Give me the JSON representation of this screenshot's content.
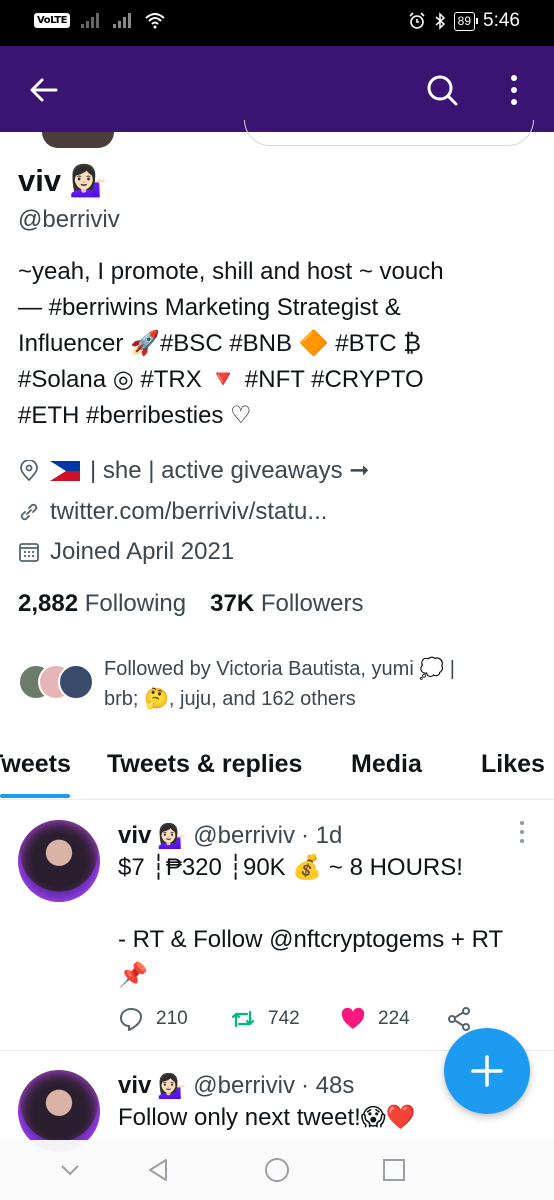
{
  "status_bar": {
    "network_badge": "VoLTE",
    "battery": "89",
    "time": "5:46",
    "icons": [
      "signal-icon",
      "wifi-icon",
      "alarm-icon",
      "bluetooth-icon",
      "battery-icon"
    ]
  },
  "app_bar": {
    "background": "#3b1473",
    "icons": [
      "back-arrow-icon",
      "search-icon",
      "more-vertical-icon"
    ]
  },
  "profile": {
    "name": "viv",
    "name_emoji": "💁🏻‍♀️",
    "handle": "@berriviv",
    "bio_lines": [
      "~yeah, I promote, shill and host ~ vouch",
      "— #berriwins Marketing Strategist &",
      "Influencer 🚀#BSC #BNB 🔶 #BTC ₿",
      "#Solana ◎ #TRX 🔻 #NFT #CRYPTO",
      "#ETH #berribesties ♡"
    ],
    "location": "| she | active giveaways ➞",
    "website": "twitter.com/berriviv/statu...",
    "joined": "Joined April 2021",
    "following_count": "2,882",
    "following_label": "Following",
    "followers_count": "37K",
    "followers_label": "Followers",
    "followed_by_line1": "Followed by Victoria Bautista, yumi 💭 |",
    "followed_by_line2": "brb; 🤔, juju, and 162 others"
  },
  "tabs": [
    "Tweets",
    "Tweets & replies",
    "Media",
    "Likes"
  ],
  "active_tab": "Tweets",
  "tweets": [
    {
      "name": "viv",
      "emoji": "💁🏻‍♀️",
      "handle": "@berriviv",
      "time": "· 1d",
      "lines": [
        "$7 ┆₱320 ┆90K 💰 ~ 8 HOURS!",
        "",
        "- RT & Follow @nftcryptogems + RT",
        "📌"
      ],
      "replies": "210",
      "retweets": "742",
      "likes": "224"
    },
    {
      "name": "viv",
      "emoji": "💁🏻‍♀️",
      "handle": "@berriviv",
      "time": "· 48s",
      "lines": [
        "Follow only next tweet!😱❤️"
      ]
    }
  ],
  "colors": {
    "accent": "#1d9bf0",
    "retweet": "#00ba7c",
    "like": "#f91880",
    "app_bar": "#3b1473"
  },
  "fab_icon": "plus-icon",
  "nav_icons": [
    "nav-hide-icon",
    "nav-back-icon",
    "nav-home-icon",
    "nav-recents-icon"
  ]
}
